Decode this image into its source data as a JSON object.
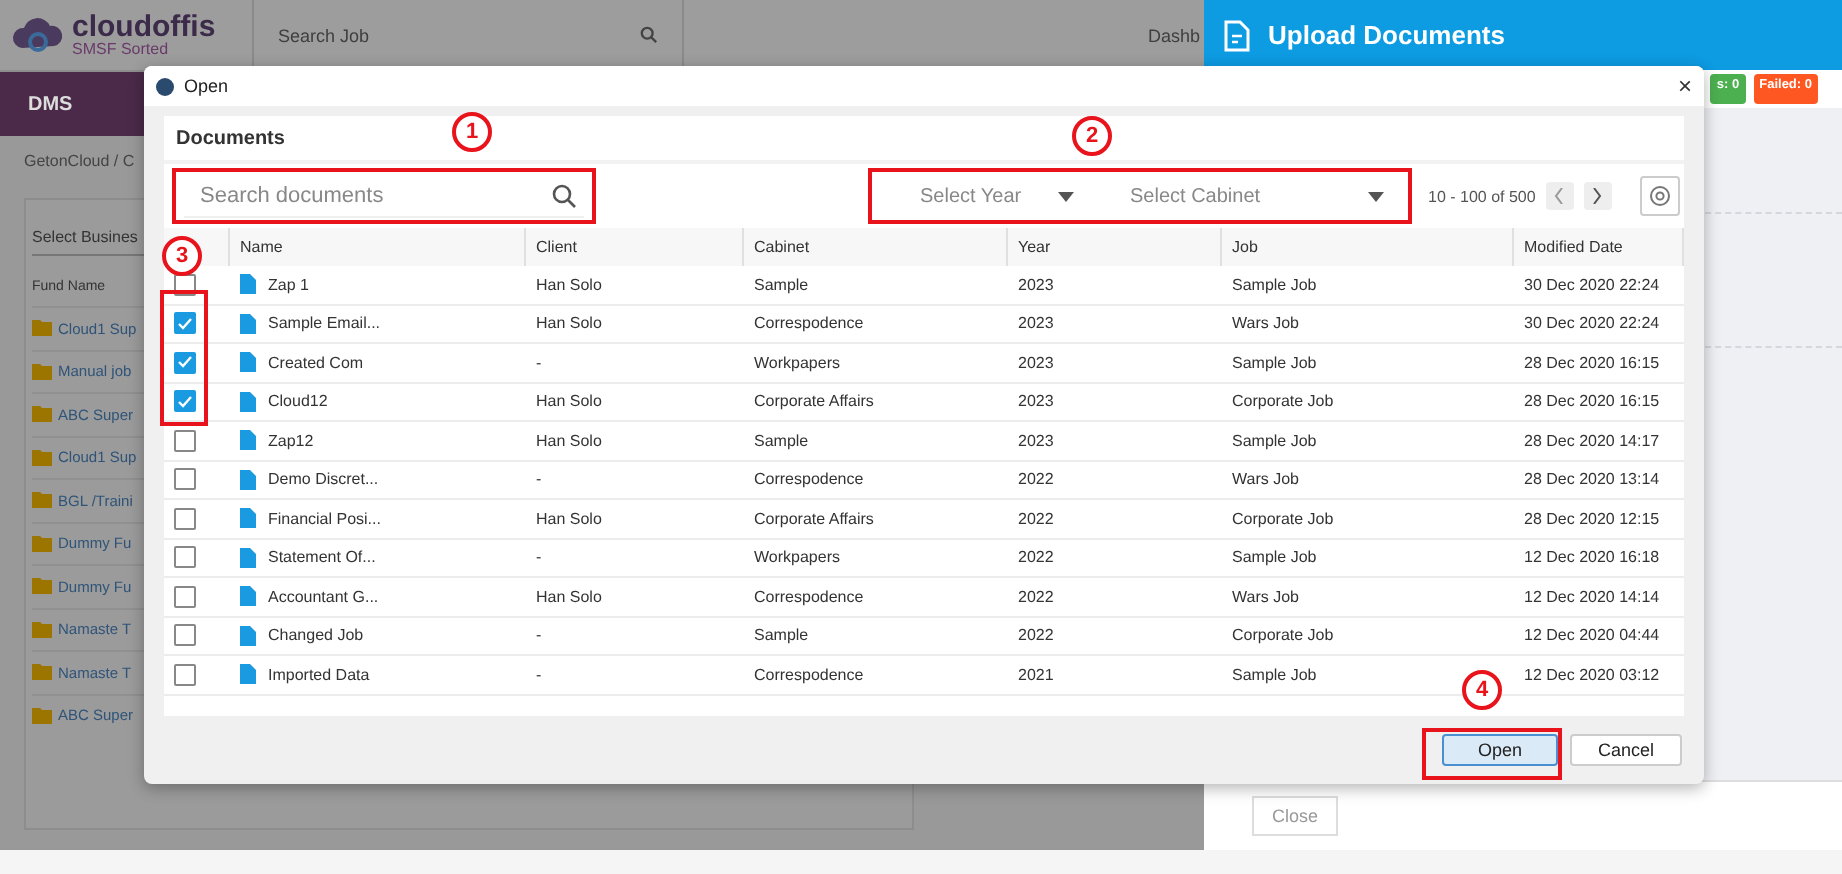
{
  "app": {
    "logo": {
      "name": "cloudoffis",
      "tagline": "SMSF Sorted"
    },
    "search": {
      "placeholder": "Search Job"
    },
    "nav_text": "Dashb",
    "section_title": "DMS",
    "breadcrumb": "GetonCloud / C",
    "fund_panel": {
      "select_placeholder": "Select Busines",
      "column": "Fund Name",
      "funds": [
        "Cloud1 Sup",
        "Manual job",
        "ABC Super",
        "Cloud1 Sup",
        "BGL /Traini",
        "Dummy Fu",
        "Dummy Fu",
        "Namaste T",
        "Namaste T",
        "ABC Super"
      ]
    }
  },
  "upload_panel": {
    "title": "Upload Documents",
    "badges": [
      {
        "label": "s: 0",
        "color": "#4caf50"
      },
      {
        "label": "Failed: 0",
        "color": "#ff5722"
      }
    ],
    "close_button": "Close"
  },
  "dialog": {
    "title": "Open",
    "close_glyph": "×",
    "heading": "Documents",
    "search": {
      "placeholder": "Search documents"
    },
    "filters": [
      {
        "placeholder": "Select Year"
      },
      {
        "placeholder": "Select Cabinet"
      }
    ],
    "pagination": "10 - 100 of 500",
    "columns": [
      "Name",
      "Client",
      "Cabinet",
      "Year",
      "Job",
      "Modified Date"
    ],
    "rows": [
      {
        "checked": false,
        "cells": [
          "Zap 1",
          "Han Solo",
          "Sample",
          "2023",
          "Sample Job",
          "30 Dec 2020 22:24"
        ]
      },
      {
        "checked": true,
        "cells": [
          "Sample Email...",
          "Han Solo",
          "Correspodence",
          "2023",
          "Wars Job",
          "30 Dec 2020 22:24"
        ]
      },
      {
        "checked": true,
        "cells": [
          "Created Com",
          "-",
          "Workpapers",
          "2023",
          "Sample Job",
          "28 Dec 2020 16:15"
        ]
      },
      {
        "checked": true,
        "cells": [
          "Cloud12",
          "Han Solo",
          "Corporate Affairs",
          "2023",
          "Corporate Job",
          "28 Dec 2020 16:15"
        ]
      },
      {
        "checked": false,
        "cells": [
          "Zap12",
          "Han Solo",
          "Sample",
          "2023",
          "Sample Job",
          "28 Dec 2020 14:17"
        ]
      },
      {
        "checked": false,
        "cells": [
          "Demo Discret...",
          "-",
          "Correspodence",
          "2022",
          "Wars Job",
          "28 Dec 2020 13:14"
        ]
      },
      {
        "checked": false,
        "cells": [
          "Financial Posi...",
          "Han Solo",
          "Corporate Affairs",
          "2022",
          "Corporate Job",
          "28 Dec 2020 12:15"
        ]
      },
      {
        "checked": false,
        "cells": [
          "Statement Of...",
          "-",
          "Workpapers",
          "2022",
          "Sample Job",
          "12 Dec 2020 16:18"
        ]
      },
      {
        "checked": false,
        "cells": [
          "Accountant G...",
          "Han Solo",
          "Correspodence",
          "2022",
          "Wars Job",
          "12 Dec 2020 14:14"
        ]
      },
      {
        "checked": false,
        "cells": [
          "Changed Job",
          "-",
          "Sample",
          "2022",
          "Corporate Job",
          "12 Dec 2020 04:44"
        ]
      },
      {
        "checked": false,
        "cells": [
          "Imported Data",
          "-",
          "Correspodence",
          "2021",
          "Sample Job",
          "12 Dec 2020 03:12"
        ]
      }
    ],
    "buttons": [
      {
        "label": "Open",
        "selected": true
      },
      {
        "label": "Cancel",
        "selected": false
      }
    ]
  },
  "annotations": [
    {
      "label": "1"
    },
    {
      "label": "2"
    },
    {
      "label": "3"
    },
    {
      "label": "4"
    }
  ]
}
